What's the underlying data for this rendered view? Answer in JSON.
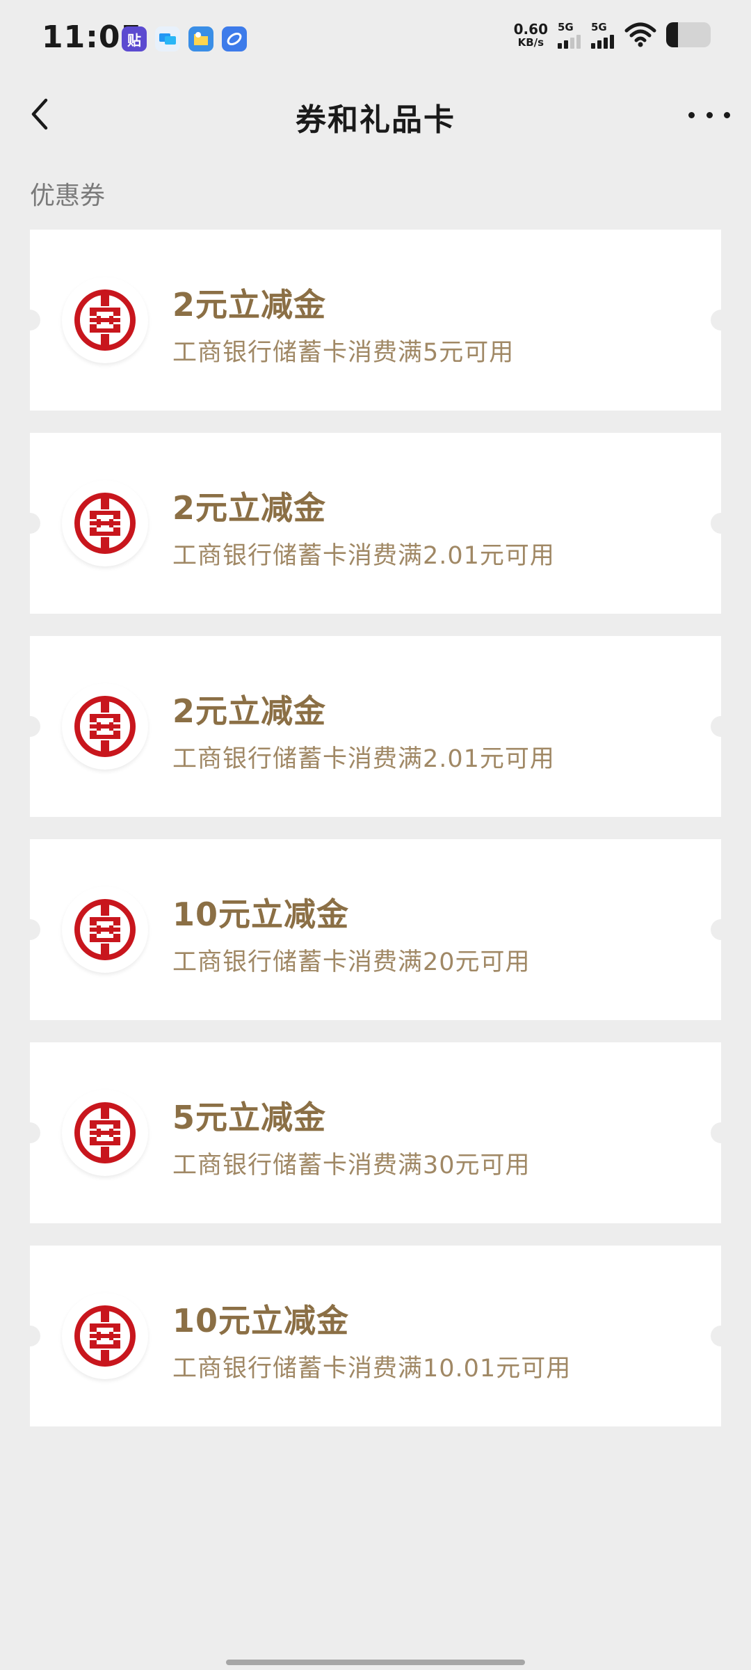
{
  "status_bar": {
    "time": "11:05",
    "net_speed_value": "0.60",
    "net_speed_unit": "KB/s",
    "sim1_label": "5G",
    "sim2_label": "5G",
    "app_icons": [
      {
        "name": "tieba-icon",
        "glyph": "贴",
        "color": "#5b4ad0"
      },
      {
        "name": "messenger-icon",
        "glyph": "",
        "color": "#2196f3"
      },
      {
        "name": "folder-app-icon",
        "glyph": "",
        "color": "#3a8ee6"
      },
      {
        "name": "browser-icon",
        "glyph": "",
        "color": "#3d7bea"
      }
    ],
    "battery_level": 0.26
  },
  "nav": {
    "title": "券和礼品卡"
  },
  "section": {
    "label": "优惠券"
  },
  "coupons": [
    {
      "title": "2元立减金",
      "desc": "工商银行储蓄卡消费满5元可用"
    },
    {
      "title": "2元立减金",
      "desc": "工商银行储蓄卡消费满2.01元可用"
    },
    {
      "title": "2元立减金",
      "desc": "工商银行储蓄卡消费满2.01元可用"
    },
    {
      "title": "10元立减金",
      "desc": "工商银行储蓄卡消费满20元可用"
    },
    {
      "title": "5元立减金",
      "desc": "工商银行储蓄卡消费满30元可用"
    },
    {
      "title": "10元立减金",
      "desc": "工商银行储蓄卡消费满10.01元可用"
    }
  ],
  "colors": {
    "coupon_title": "#8b6f45",
    "coupon_desc": "#a08865",
    "icbc_red": "#c8161d",
    "background": "#ededed"
  }
}
